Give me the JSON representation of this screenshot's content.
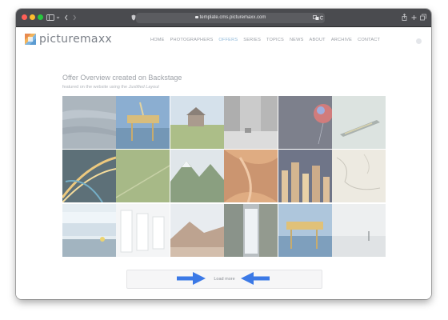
{
  "browser": {
    "url": "template.cms.picturemaxx.com"
  },
  "site": {
    "logo_text": "picturemaxx",
    "nav": [
      {
        "label": "HOME",
        "active": false
      },
      {
        "label": "PHOTOGRAPHERS",
        "active": false
      },
      {
        "label": "OFFERS",
        "active": true
      },
      {
        "label": "SERIES",
        "active": false
      },
      {
        "label": "TOPICS",
        "active": false
      },
      {
        "label": "NEWS",
        "active": false
      },
      {
        "label": "ABOUT",
        "active": false
      },
      {
        "label": "ARCHIVE",
        "active": false
      },
      {
        "label": "CONTACT",
        "active": false
      }
    ]
  },
  "page": {
    "title": "Offer Overview created on Backstage",
    "subtitle_prefix": "featured on the website using the",
    "subtitle_emphasis": "Justified Layout",
    "load_more_label": "Load more"
  },
  "colors": {
    "accent_nav": "#8fb8d9",
    "arrow": "#3b79e6"
  },
  "gallery": {
    "rows": [
      [
        "water-surface",
        "offshore-oil-platform",
        "farmhouse-field",
        "old-city-street-bw",
        "red-balloon-space",
        "aerial-ship-sea"
      ],
      [
        "light-trails",
        "green-field-path",
        "mountain-valley",
        "abstract-orange-fold",
        "city-skyline-night",
        "old-map"
      ],
      [
        "ice-waterfall-hiker",
        "server-room",
        "desert-mountain",
        "waterfall-cliff",
        "offshore-platform-sunset",
        "foggy-beach-figure"
      ]
    ]
  }
}
